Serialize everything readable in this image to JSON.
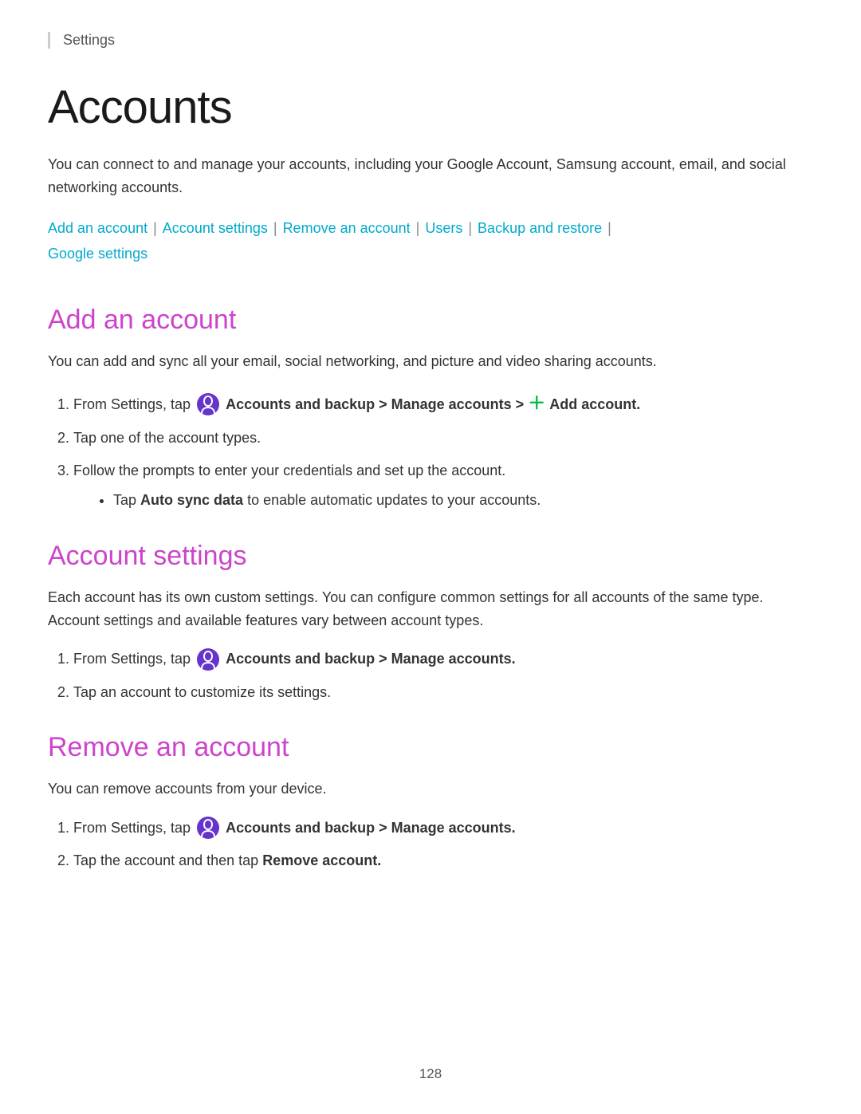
{
  "breadcrumb": {
    "label": "Settings"
  },
  "page": {
    "title": "Accounts",
    "intro": "You can connect to and manage your accounts, including your Google Account, Samsung account, email, and social networking accounts."
  },
  "nav_links": {
    "add_account": "Add an account",
    "account_settings": "Account settings",
    "remove_account": "Remove an account",
    "users": "Users",
    "backup_restore": "Backup and restore",
    "google_settings": "Google settings"
  },
  "sections": {
    "add_account": {
      "title": "Add an account",
      "intro": "You can add and sync all your email, social networking, and picture and video sharing accounts.",
      "steps": [
        {
          "id": 1,
          "text_before": "From Settings, tap",
          "bold_part": "Accounts and backup > Manage accounts >",
          "icon": "accounts",
          "plus": true,
          "text_after": "Add account."
        },
        {
          "id": 2,
          "text": "Tap one of the account types."
        },
        {
          "id": 3,
          "text": "Follow the prompts to enter your credentials and set up the account.",
          "bullet": "Tap Auto sync data to enable automatic updates to your accounts."
        }
      ]
    },
    "account_settings": {
      "title": "Account settings",
      "intro": "Each account has its own custom settings. You can configure common settings for all accounts of the same type. Account settings and available features vary between account types.",
      "steps": [
        {
          "id": 1,
          "text_before": "From Settings, tap",
          "bold_part": "Accounts and backup > Manage accounts.",
          "icon": "accounts"
        },
        {
          "id": 2,
          "text": "Tap an account to customize its settings."
        }
      ]
    },
    "remove_account": {
      "title": "Remove an account",
      "intro": "You can remove accounts from your device.",
      "steps": [
        {
          "id": 1,
          "text_before": "From Settings, tap",
          "bold_part": "Accounts and backup > Manage accounts.",
          "icon": "accounts"
        },
        {
          "id": 2,
          "text_before": "Tap the account and then tap",
          "bold_part": "Remove account."
        }
      ]
    }
  },
  "footer": {
    "page_number": "128"
  },
  "colors": {
    "accent": "#cc44cc",
    "link": "#00aacc",
    "text": "#333333",
    "heading": "#1a1a1a",
    "icon_bg": "#6633cc",
    "plus_color": "#00bb44"
  }
}
